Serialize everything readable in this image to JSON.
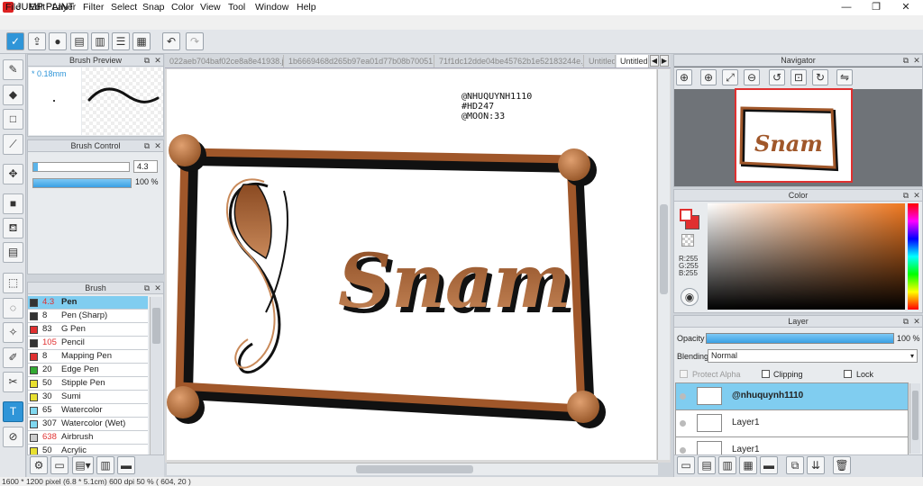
{
  "app": {
    "title": "JUMP PAINT"
  },
  "window": {
    "minimize": "—",
    "maximize": "❐",
    "close": "✕"
  },
  "menu": [
    "File",
    "Edit",
    "Layer",
    "Filter",
    "Select",
    "Snap",
    "Color",
    "View",
    "Tool",
    "Window",
    "Help"
  ],
  "tabs": [
    "022aeb704baf02ce8a8e41938.jpg",
    "1b6669468d265b97ea01d77b08b70051.jpg",
    "71f1dc12dde04be45762b1e52183244e.jpg",
    "Untitled",
    "Untitled"
  ],
  "brush_preview": {
    "title": "Brush Preview",
    "size": "* 0.18mm"
  },
  "brush_control": {
    "title": "Brush Control",
    "size_value": "4.3",
    "opacity_value": "100 %",
    "opacity_fill": 1.0,
    "size_fill": 0.05
  },
  "brush_panel": {
    "title": "Brush",
    "items": [
      {
        "size": "4.3",
        "name": "Pen",
        "color": "#333333",
        "size_color": "#e03030",
        "selected": true
      },
      {
        "size": "8",
        "name": "Pen (Sharp)",
        "color": "#333333",
        "size_color": "#222222"
      },
      {
        "size": "83",
        "name": "G Pen",
        "color": "#e03030",
        "size_color": "#222222"
      },
      {
        "size": "105",
        "name": "Pencil",
        "color": "#333333",
        "size_color": "#e03030"
      },
      {
        "size": "8",
        "name": "Mapping Pen",
        "color": "#e03030",
        "size_color": "#222222"
      },
      {
        "size": "20",
        "name": "Edge Pen",
        "color": "#33aa33",
        "size_color": "#222222"
      },
      {
        "size": "50",
        "name": "Stipple Pen",
        "color": "#e8e030",
        "size_color": "#222222"
      },
      {
        "size": "30",
        "name": "Sumi",
        "color": "#e8e030",
        "size_color": "#222222"
      },
      {
        "size": "65",
        "name": "Watercolor",
        "color": "#80d8f0",
        "size_color": "#222222"
      },
      {
        "size": "307",
        "name": "Watercolor (Wet)",
        "color": "#80d8f0",
        "size_color": "#222222"
      },
      {
        "size": "638",
        "name": "Airbrush",
        "color": "#cccccc",
        "size_color": "#e03030"
      },
      {
        "size": "50",
        "name": "Acrylic",
        "color": "#e8e030",
        "size_color": "#222222"
      }
    ]
  },
  "navigator": {
    "title": "Navigator"
  },
  "color_panel": {
    "title": "Color",
    "r": "R:255",
    "g": "G:255",
    "b": "B:255"
  },
  "layer_panel": {
    "title": "Layer",
    "opacity_label": "Opacity",
    "opacity_value": "100 %",
    "blending_label": "Blending",
    "blending_value": "Normal",
    "protect_alpha": "Protect Alpha",
    "clipping": "Clipping",
    "lock": "Lock",
    "layers": [
      {
        "name": "@nhuquynh1110",
        "selected": true
      },
      {
        "name": "Layer1",
        "selected": false
      },
      {
        "name": "Layer1",
        "selected": false
      }
    ]
  },
  "canvas": {
    "credits": [
      "@NHUQUYNH1110",
      "#HD247",
      "@MOON:33"
    ],
    "text": "Snam",
    "brown": "#a0572a",
    "light_brown": "#c98a5a"
  },
  "status": {
    "text": "1600 * 1200 pixel   (6.8 * 5.1cm)   600 dpi   50 %   ( 604, 20 )"
  }
}
